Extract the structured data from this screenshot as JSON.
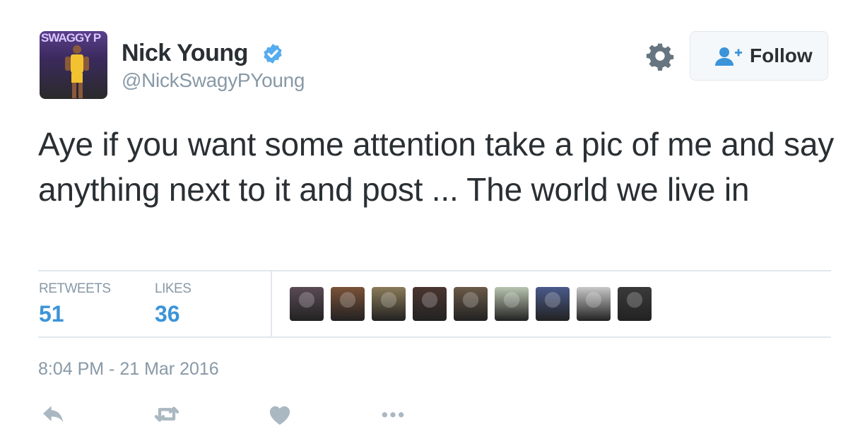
{
  "author": {
    "name": "Nick Young",
    "handle": "@NickSwagyPYoung",
    "verified": true,
    "avatar_icon": "profile-photo",
    "avatar_brand_text": "SWAGGY P"
  },
  "header": {
    "settings_icon": "gear-icon",
    "follow_label": "Follow",
    "follow_icon": "add-user-icon"
  },
  "tweet": {
    "text": "Aye if you want some attention take a pic of me and say anything next to it and post ... The world we live in",
    "timestamp": "8:04 PM - 21 Mar 2016"
  },
  "stats": {
    "retweets_label": "RETWEETS",
    "retweets_count": "51",
    "likes_label": "LIKES",
    "likes_count": "36"
  },
  "likers": {
    "count_shown": 9,
    "colors": [
      "#5a4a55",
      "#7a5238",
      "#8a7a58",
      "#4a3530",
      "#6a5a48",
      "#b8c4b0",
      "#4a5a8a",
      "#c8c8c8",
      "#3a3a3a"
    ]
  },
  "actions": [
    {
      "name": "reply-icon"
    },
    {
      "name": "retweet-icon"
    },
    {
      "name": "like-icon"
    },
    {
      "name": "more-icon"
    }
  ],
  "colors": {
    "accent": "#3b94d9",
    "verified": "#55acee",
    "muted": "#8899a6",
    "text": "#292f33",
    "border": "#e1e8ed"
  }
}
